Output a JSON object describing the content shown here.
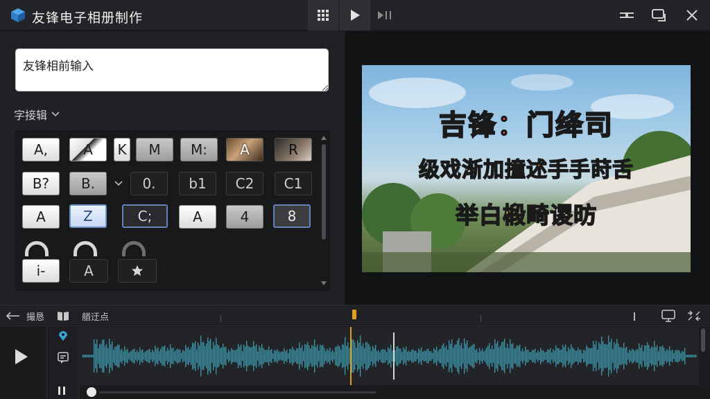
{
  "app": {
    "title": "友锋电子相册制作"
  },
  "left_panel": {
    "input_value": "友锋相前输入",
    "dropdown_label": "字接辑"
  },
  "style_rows": [
    [
      "A,",
      "A",
      "K",
      "M",
      "M:",
      "A",
      "R"
    ],
    [
      "B?",
      "B.",
      "",
      "0.",
      "b1",
      "C2",
      "C1"
    ],
    [
      "A",
      "Z",
      "C;",
      "A",
      "4",
      "8"
    ],
    [
      "i-",
      "A",
      ""
    ]
  ],
  "preview": {
    "line1": "吉锋：门绛司",
    "line2": "级戏渐加撞述手手莳舌",
    "line3": "举白椴畸谡昉"
  },
  "timeline": {
    "label_left": "撮恳",
    "label_mid": "艏迂点"
  },
  "icons": {
    "grid": "grid-icon",
    "play": "play-icon",
    "next": "skip-next-icon",
    "minimize": "minimize-icon",
    "restore": "restore-icon",
    "close": "close-icon"
  },
  "colors": {
    "waveform": "#3b93a8",
    "playhead": "#e0a020",
    "accent": "#5f86b8"
  }
}
